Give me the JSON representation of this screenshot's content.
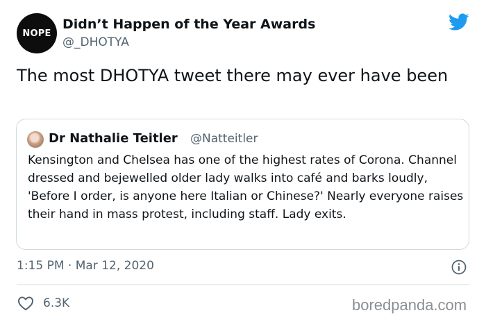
{
  "author": {
    "avatar_text": "NOPE",
    "display_name": "Didn’t Happen of the Year Awards",
    "handle": "@_DHOTYA",
    "avatar_color": "#0d0d0d"
  },
  "brand_icon": "twitter-bird-icon",
  "brand_color": "#1d9bf0",
  "tweet": {
    "text": "The most DHOTYA tweet there may ever have been"
  },
  "quoted_tweet": {
    "display_name": "Dr Nathalie Teitler",
    "handle": "@Natteitler",
    "text": "Kensington and Chelsea has one of the highest rates of Corona. Channel dressed and bejewelled older lady walks into café and barks loudly, 'Before I order, is anyone here Italian or Chinese?' Nearly everyone raises their hand in mass protest, including staff. Lady exits."
  },
  "meta": {
    "timestamp": "1:15 PM · Mar 12, 2020",
    "info_icon": "info-icon"
  },
  "actions": {
    "like_icon": "heart-icon",
    "like_count": "6.3K"
  },
  "watermark": "boredpanda.com"
}
